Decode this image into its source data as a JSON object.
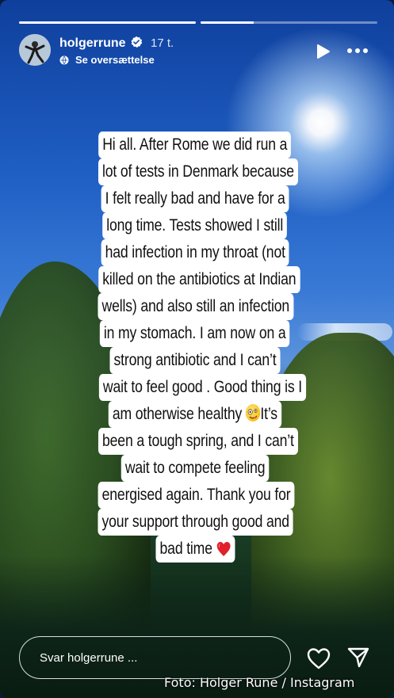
{
  "header": {
    "username": "holgerrune",
    "time": "17 t.",
    "translate_label": "Se oversættelse"
  },
  "progress": {
    "segments": 2,
    "current_segment_progress": 0.3
  },
  "caption": {
    "lines": [
      "Hi all. After Rome we did run a",
      "lot of tests in Denmark because",
      "I felt really bad and have for a",
      "long time. Tests showed I still",
      "had infection in my throat (not",
      "killed on the antibiotics at Indian",
      "wells)  and also still an infection",
      "in my stomach. I am now on a",
      "strong antibiotic and I can’t",
      "wait to feel good . Good thing is I",
      "am otherwise healthy",
      "It’s",
      "been a tough spring, and I can’t",
      "wait to compete feeling",
      "energised again. Thank you for",
      "your support through good and",
      "bad time"
    ],
    "emoji_face": "zany-face",
    "emoji_heart": "red-heart"
  },
  "footer": {
    "reply_placeholder": "Svar holgerrune ...",
    "credit": "Foto: Holger Rune / Instagram"
  },
  "icons": {
    "verified": "verified-badge-icon",
    "translate": "globe-icon",
    "play": "play-icon",
    "more": "more-icon",
    "like": "heart-outline-icon",
    "send": "send-icon"
  }
}
